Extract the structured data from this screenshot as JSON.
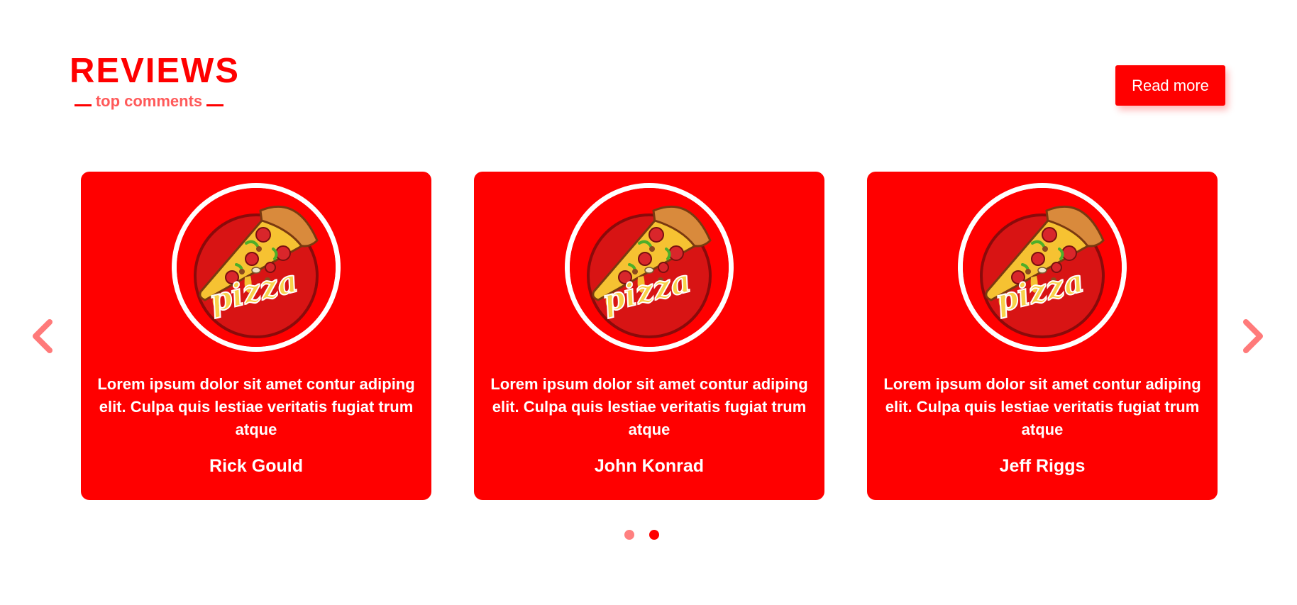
{
  "section": {
    "title": "REVIEWS",
    "subtitle": "top comments"
  },
  "read_more": {
    "label": "Read more"
  },
  "carousel": {
    "prev_icon": "chevron-left-icon",
    "next_icon": "chevron-right-icon",
    "reviews": [
      {
        "text": "Lorem ipsum dolor sit amet contur adiping elit. Culpa quis lestiae veritatis fugiat trum atque",
        "name": "Rick Gould",
        "image": "pizza-slice-logo"
      },
      {
        "text": "Lorem ipsum dolor sit amet contur adiping elit. Culpa quis lestiae veritatis fugiat trum atque",
        "name": "John Konrad",
        "image": "pizza-slice-logo"
      },
      {
        "text": "Lorem ipsum dolor sit amet contur adiping elit. Culpa quis lestiae veritatis fugiat trum atque",
        "name": "Jeff Riggs",
        "image": "pizza-slice-logo"
      }
    ],
    "pagination": {
      "page_count": 2,
      "active_page": 2
    },
    "logo_word": "pizza"
  },
  "colors": {
    "accent": "#ff0000",
    "accent_light": "#ff8080",
    "subtitle": "#ff5a5a",
    "card_text": "#ffffff"
  }
}
